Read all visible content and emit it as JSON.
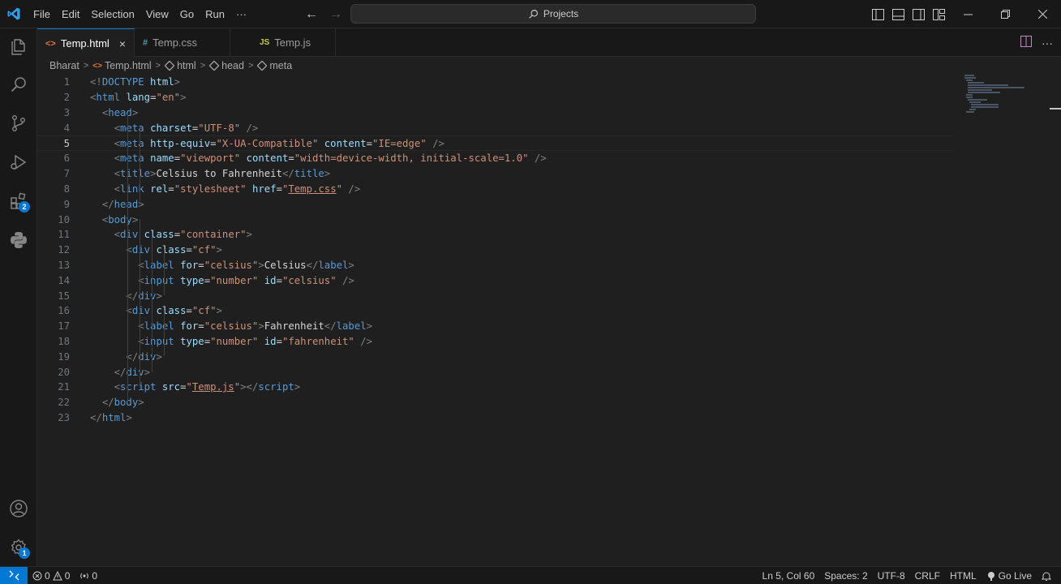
{
  "menu": {
    "items": [
      "File",
      "Edit",
      "Selection",
      "View",
      "Go",
      "Run",
      "···"
    ]
  },
  "command_center": {
    "label": "Projects"
  },
  "tabs": [
    {
      "label": "Temp.html",
      "icon": "<>",
      "icon_color": "#e37933",
      "active": true
    },
    {
      "label": "Temp.css",
      "icon": "#",
      "icon_color": "#519aba",
      "active": false
    },
    {
      "label": "Temp.js",
      "icon": "JS",
      "icon_color": "#cbcb41",
      "active": false
    }
  ],
  "tab_close": "×",
  "breadcrumb": [
    "Bharat",
    "Temp.html",
    "html",
    "head",
    "meta"
  ],
  "activity_badges": {
    "extensions": "2",
    "manage": "1"
  },
  "code_lines": [
    "1",
    "2",
    "3",
    "4",
    "5",
    "6",
    "7",
    "8",
    "9",
    "10",
    "11",
    "12",
    "13",
    "14",
    "15",
    "16",
    "17",
    "18",
    "19",
    "20",
    "21",
    "22",
    "23"
  ],
  "status": {
    "errors": "0",
    "warnings": "0",
    "ports": "0",
    "cursor": "Ln 5, Col 60",
    "spaces": "Spaces: 2",
    "encoding": "UTF-8",
    "eol": "CRLF",
    "language": "HTML",
    "go_live": "Go Live"
  },
  "colors": {
    "accent": "#0078d4",
    "tag": "#569cd6",
    "attribute": "#9cdcfe",
    "string": "#ce9178",
    "bracket": "#808080"
  }
}
